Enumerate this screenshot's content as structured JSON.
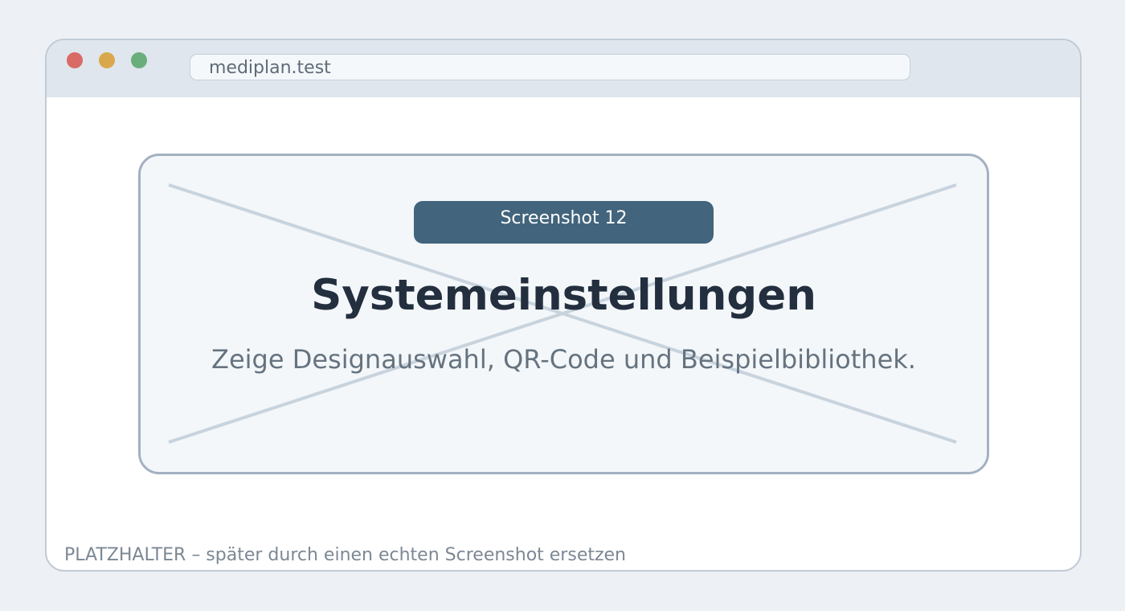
{
  "browser": {
    "address": "mediplan.test"
  },
  "placeholder": {
    "badge": "Screenshot 12",
    "title": "Systemeinstellungen",
    "subtitle": "Zeige Designauswahl, QR-Code und Beispielbibliothek."
  },
  "footer_note": "PLATZHALTER – später durch einen echten Screenshot ersetzen",
  "colors": {
    "page_background": "#edf1f5",
    "title_bar": "#dfe6ed",
    "close": "#d96b66",
    "minimize": "#d9a84d",
    "zoom": "#6aae7c",
    "card_background": "#f3f7fa",
    "card_border": "#a3b1c1",
    "badge": "#42647c",
    "title_text": "#232f3e"
  }
}
